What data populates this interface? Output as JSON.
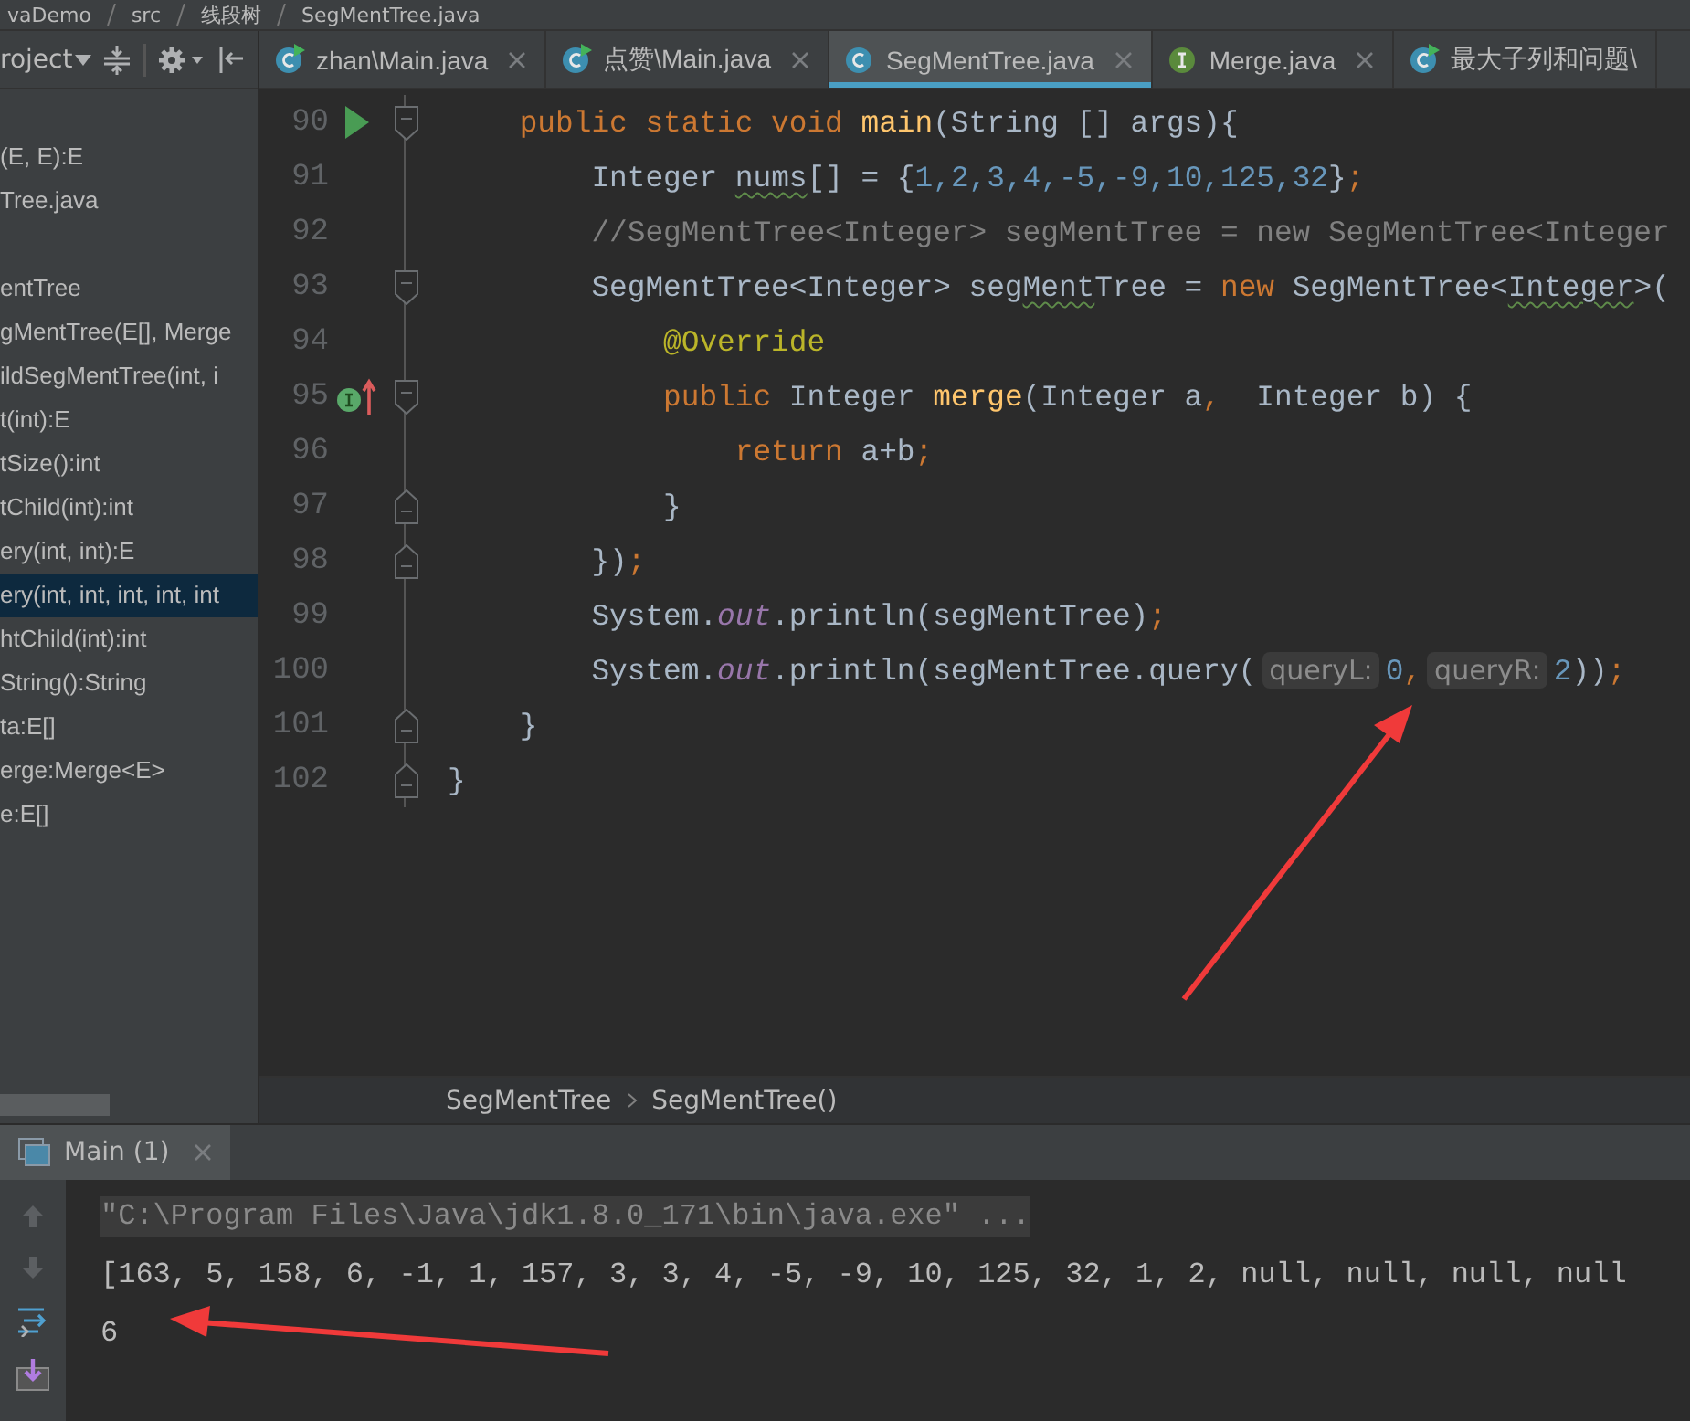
{
  "navigation_bar": {
    "items": [
      "vaDemo",
      "src",
      "线段树",
      "SegMentTree.java"
    ]
  },
  "project_panel": {
    "title": "roject",
    "items": [
      {
        "label": "(E, E):E",
        "kind": "member",
        "selected": false
      },
      {
        "label": "Tree.java",
        "kind": "member",
        "selected": false
      },
      {
        "label": "entTree",
        "kind": "group",
        "selected": false
      },
      {
        "label": "gMentTree(E[], Merge",
        "kind": "member",
        "selected": false
      },
      {
        "label": "ildSegMentTree(int, i",
        "kind": "member",
        "selected": false
      },
      {
        "label": "t(int):E",
        "kind": "member",
        "selected": false
      },
      {
        "label": "tSize():int",
        "kind": "member",
        "selected": false
      },
      {
        "label": "tChild(int):int",
        "kind": "member",
        "selected": false
      },
      {
        "label": "ery(int, int):E",
        "kind": "member",
        "selected": false
      },
      {
        "label": "ery(int, int, int, int, int",
        "kind": "member",
        "selected": true
      },
      {
        "label": "htChild(int):int",
        "kind": "member",
        "selected": false
      },
      {
        "label": "String():String",
        "kind": "member",
        "selected": false
      },
      {
        "label": "ta:E[]",
        "kind": "member",
        "selected": false
      },
      {
        "label": "erge:Merge<E>",
        "kind": "member",
        "selected": false
      },
      {
        "label": "e:E[]",
        "kind": "member",
        "selected": false
      }
    ]
  },
  "tabs": [
    {
      "label": "zhan\\Main.java",
      "kind": "runnable_class",
      "selected": false,
      "closable": true
    },
    {
      "label": "点赞\\Main.java",
      "kind": "runnable_class",
      "selected": false,
      "closable": true
    },
    {
      "label": "SegMentTree.java",
      "kind": "class",
      "selected": true,
      "closable": true
    },
    {
      "label": "Merge.java",
      "kind": "interface",
      "selected": false,
      "closable": true
    },
    {
      "label": "最大子列和问题\\",
      "kind": "runnable_class",
      "selected": false,
      "closable": false
    }
  ],
  "code": {
    "lines": [
      {
        "number": "90",
        "gutter_icon": {
          "kind": "run"
        },
        "fold_marker": {
          "kind": "start"
        },
        "tokens": [
          {
            "kind": "keyword",
            "text": "    public static void "
          },
          {
            "kind": "method",
            "text": "main"
          },
          {
            "kind": "plain",
            "text": "(String [] args){"
          }
        ]
      },
      {
        "number": "91",
        "tokens": [
          {
            "kind": "plain",
            "text": "        Integer "
          },
          {
            "kind": "plain",
            "text": "nums",
            "squiggle": true
          },
          {
            "kind": "plain",
            "text": "[] = {"
          },
          {
            "kind": "number",
            "text": "1,2,3,4,-5,-9,10,125,32"
          },
          {
            "kind": "plain",
            "text": "}"
          },
          {
            "kind": "keyword",
            "text": ";"
          }
        ]
      },
      {
        "number": "92",
        "tokens": [
          {
            "kind": "comment",
            "text": "        //SegMentTree<Integer> segMentTree = new SegMentTree<Integer"
          }
        ]
      },
      {
        "number": "93",
        "fold_marker": {
          "kind": "start"
        },
        "tokens": [
          {
            "kind": "plain",
            "text": "        SegMentTree<Integer> seg"
          },
          {
            "kind": "plain",
            "text": "Ment",
            "squiggle": true
          },
          {
            "kind": "plain",
            "text": "Tree = "
          },
          {
            "kind": "keyword",
            "text": "new"
          },
          {
            "kind": "plain",
            "text": " SegMentTree<"
          },
          {
            "kind": "plain",
            "text": "Integer",
            "squiggle": true
          },
          {
            "kind": "plain",
            "text": ">("
          }
        ]
      },
      {
        "number": "94",
        "tokens": [
          {
            "kind": "annotation",
            "text": "            @Override"
          }
        ]
      },
      {
        "number": "95",
        "gutter_icon": {
          "kind": "implements"
        },
        "fold_marker": {
          "kind": "start"
        },
        "tokens": [
          {
            "kind": "keyword",
            "text": "            public "
          },
          {
            "kind": "plain",
            "text": "Integer "
          },
          {
            "kind": "method",
            "text": "merge"
          },
          {
            "kind": "plain",
            "text": "(Integer a"
          },
          {
            "kind": "keyword",
            "text": ","
          },
          {
            "kind": "plain",
            "text": "  Integer b) {"
          }
        ]
      },
      {
        "number": "96",
        "tokens": [
          {
            "kind": "keyword",
            "text": "                return "
          },
          {
            "kind": "plain",
            "text": "a+b"
          },
          {
            "kind": "keyword",
            "text": ";"
          }
        ]
      },
      {
        "number": "97",
        "fold_marker": {
          "kind": "end"
        },
        "tokens": [
          {
            "kind": "plain",
            "text": "            }"
          }
        ]
      },
      {
        "number": "98",
        "fold_marker": {
          "kind": "end"
        },
        "tokens": [
          {
            "kind": "plain",
            "text": "        })"
          },
          {
            "kind": "keyword",
            "text": ";"
          }
        ]
      },
      {
        "number": "99",
        "tokens": [
          {
            "kind": "plain",
            "text": "        System."
          },
          {
            "kind": "field",
            "text": "out"
          },
          {
            "kind": "plain",
            "text": ".println(segMentTree)"
          },
          {
            "kind": "keyword",
            "text": ";"
          }
        ]
      },
      {
        "number": "100",
        "tokens": [
          {
            "kind": "plain",
            "text": "        System."
          },
          {
            "kind": "field",
            "text": "out"
          },
          {
            "kind": "plain",
            "text": ".println(segMentTree.query("
          },
          {
            "kind": "hint",
            "text": "queryL:"
          },
          {
            "kind": "number",
            "text": "0"
          },
          {
            "kind": "keyword",
            "text": ","
          },
          {
            "kind": "hint",
            "text": "queryR:"
          },
          {
            "kind": "number",
            "text": "2"
          },
          {
            "kind": "plain",
            "text": "))"
          },
          {
            "kind": "keyword",
            "text": ";"
          }
        ]
      },
      {
        "number": "101",
        "fold_marker": {
          "kind": "end"
        },
        "tokens": [
          {
            "kind": "plain",
            "text": "    }"
          }
        ]
      },
      {
        "number": "102",
        "fold_marker": {
          "kind": "end"
        },
        "tokens": [
          {
            "kind": "plain",
            "text": "}"
          }
        ]
      }
    ]
  },
  "breadcrumbs": [
    "SegMentTree",
    "SegMentTree()"
  ],
  "run_panel": {
    "tab": {
      "label": "Main (1)",
      "selected": true
    },
    "lines": [
      {
        "kind": "command",
        "text": "\"C:\\Program Files\\Java\\jdk1.8.0_171\\bin\\java.exe\" ..."
      },
      {
        "kind": "output",
        "text": "[163, 5, 158, 6, -1, 1, 157, 3, 3, 4, -5, -9, 10, 125, 32, 1, 2, null, null, null, null"
      },
      {
        "kind": "output",
        "text": "6"
      }
    ]
  }
}
